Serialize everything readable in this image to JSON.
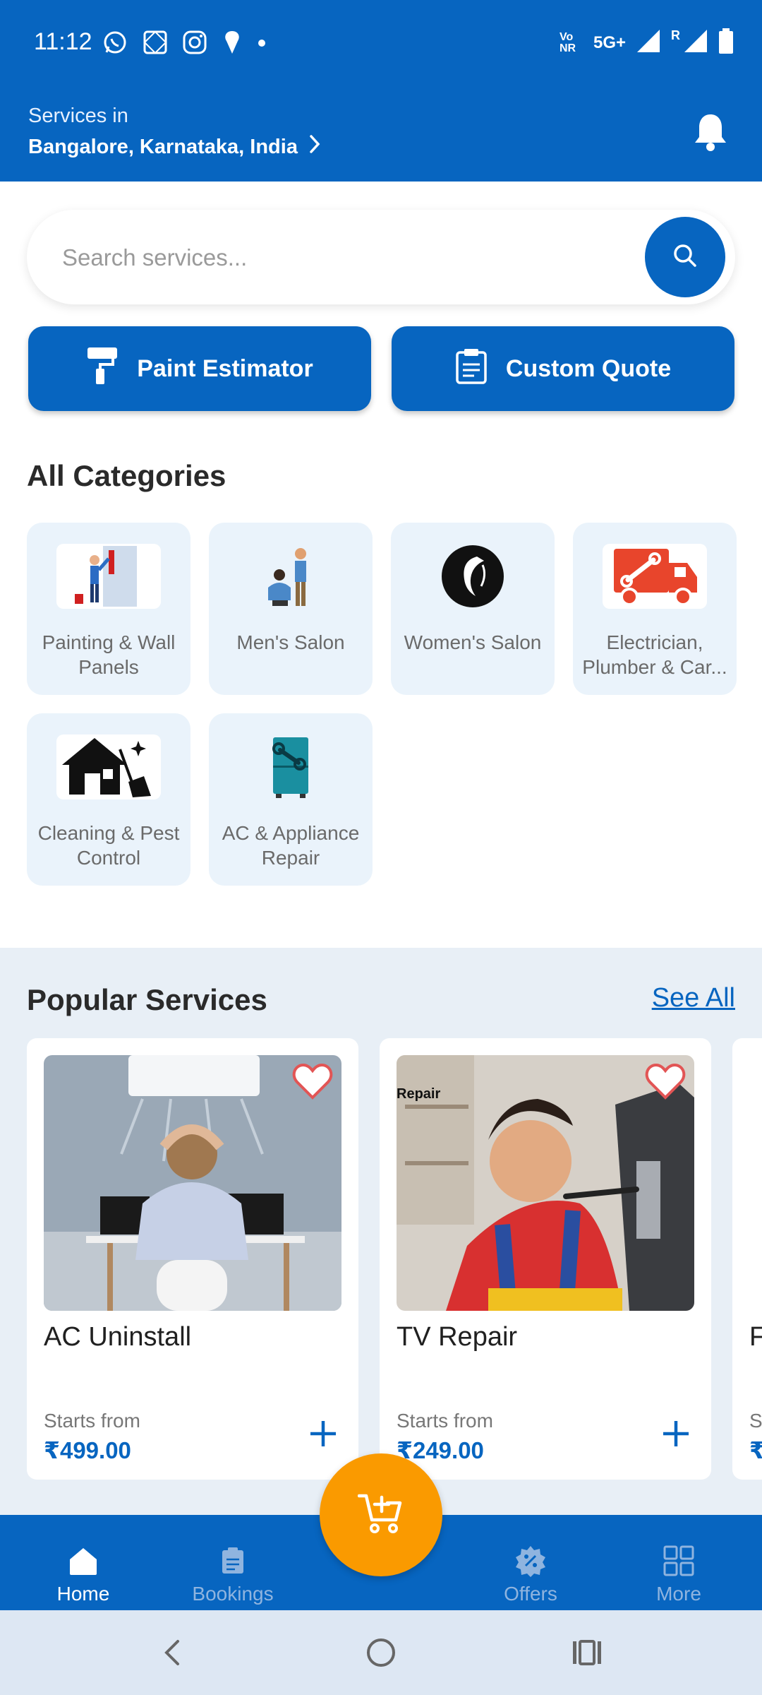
{
  "status_bar": {
    "time": "11:12",
    "left_icons": [
      "whatsapp-icon",
      "gallery-icon",
      "instagram-icon",
      "swiggy-icon",
      "dot-icon"
    ],
    "network": "5G+",
    "volte": "Vo NR",
    "roaming": "R"
  },
  "header": {
    "location_label": "Services in",
    "location_value": "Bangalore, Karnataka, India"
  },
  "search": {
    "placeholder": "Search services..."
  },
  "actions": {
    "paint_estimator": "Paint Estimator",
    "custom_quote": "Custom Quote"
  },
  "categories": {
    "title": "All Categories",
    "items": [
      {
        "label": "Painting & Wall Panels"
      },
      {
        "label": "Men's Salon"
      },
      {
        "label": "Women's Salon"
      },
      {
        "label": "Electrician, Plumber & Car..."
      },
      {
        "label": "Cleaning & Pest Control"
      },
      {
        "label": "AC & Appliance Repair"
      }
    ]
  },
  "popular": {
    "title": "Popular Services",
    "see_all": "See All",
    "items": [
      {
        "name": "AC Uninstall",
        "from": "Starts from",
        "price": "₹499.00"
      },
      {
        "name": "TV Repair",
        "from": "Starts from",
        "price": "₹249.00",
        "image_text": "Repair"
      },
      {
        "name": "F",
        "from": "S",
        "price": "₹"
      }
    ]
  },
  "bottom_nav": {
    "items": [
      {
        "label": "Home",
        "icon": "home-icon",
        "active": true
      },
      {
        "label": "Bookings",
        "icon": "clipboard-icon",
        "active": false
      },
      {
        "label": "Offers",
        "icon": "offers-badge-icon",
        "active": false
      },
      {
        "label": "More",
        "icon": "grid-icon",
        "active": false
      }
    ]
  },
  "colors": {
    "primary": "#0765c0",
    "accent": "#fa9a00",
    "category_bg": "#eaf3fb"
  }
}
